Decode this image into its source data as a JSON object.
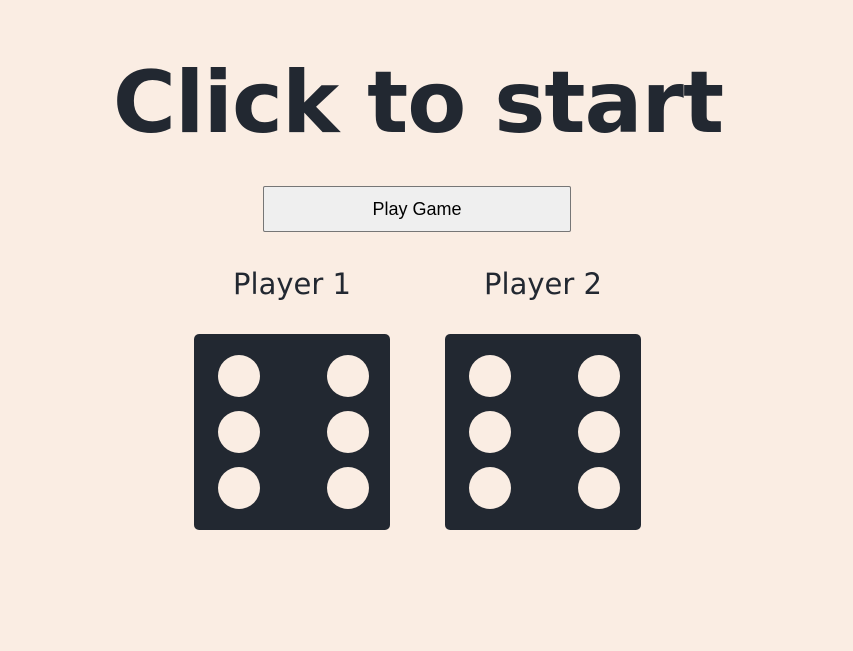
{
  "title": "Click to start",
  "play_button_label": "Play Game",
  "players": [
    {
      "name": "Player 1",
      "die_value": 6
    },
    {
      "name": "Player 2",
      "die_value": 6
    }
  ],
  "colors": {
    "background": "#FAEDE3",
    "die": "#222831",
    "pip": "#FAEDE3",
    "text": "#222831"
  }
}
